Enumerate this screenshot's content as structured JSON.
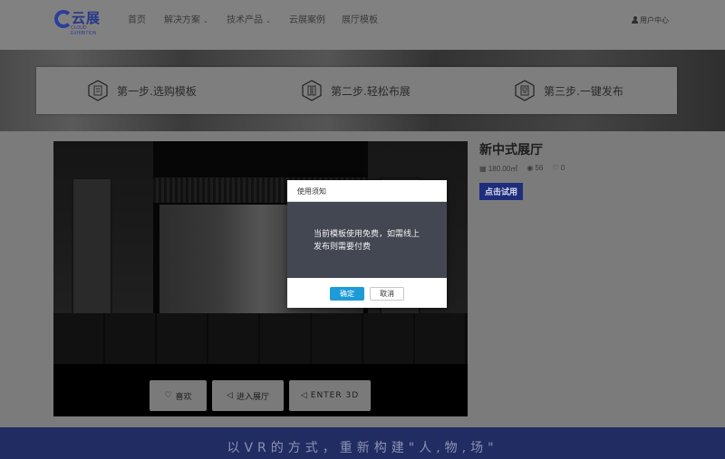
{
  "nav": {
    "logo_text": "云展",
    "logo_sub": "CLOUD EXHIBITION",
    "items": [
      {
        "label": "首页"
      },
      {
        "label": "解决方案"
      },
      {
        "label": "技术产品"
      },
      {
        "label": "云展案例"
      },
      {
        "label": "展厅模板"
      }
    ],
    "user_center": "用户中心"
  },
  "steps": [
    {
      "label": "第一步.选购模板",
      "icon": "template-icon"
    },
    {
      "label": "第二步.轻松布展",
      "icon": "layout-icon"
    },
    {
      "label": "第三步.一键发布",
      "icon": "publish-icon"
    }
  ],
  "template": {
    "title": "新中式展厅",
    "area": "180.00㎡",
    "views": "56",
    "likes": "0",
    "try_button": "点击试用"
  },
  "actions": {
    "like": "喜欢",
    "enter": "进入展厅",
    "enter3d": "ENTER 3D"
  },
  "footer": {
    "slogan": "以VR的方式，重新构建\"人,物,场\""
  },
  "modal": {
    "title": "使用须知",
    "message": "当前模板使用免费，如需线上发布则需要付费",
    "confirm": "确定",
    "cancel": "取消"
  },
  "colors": {
    "brand": "#27378a",
    "footer": "#212c63",
    "confirm": "#1e9bd7",
    "modal_body": "#424752"
  }
}
